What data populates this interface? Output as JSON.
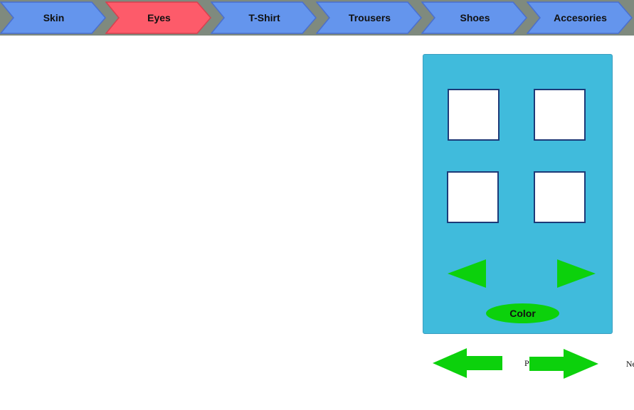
{
  "tabs": [
    {
      "label": "Skin",
      "active": false
    },
    {
      "label": "Eyes",
      "active": true
    },
    {
      "label": "T-Shirt",
      "active": false
    },
    {
      "label": "Trousers",
      "active": false
    },
    {
      "label": "Shoes",
      "active": false
    },
    {
      "label": "Accesories",
      "active": false
    }
  ],
  "colors": {
    "tab": "#6495ed",
    "tab_active": "#fd5b6a",
    "tab_border": "#4a6fcf",
    "tab_active_border": "#d8404f",
    "strip": "#7f8a7e",
    "panel": "#40bbdc",
    "green": "#0cd10c"
  },
  "panel": {
    "color_label": "Color",
    "prev_option_icon": "triangle-left-icon",
    "next_option_icon": "triangle-right-icon"
  },
  "navigation": {
    "previous_label": "Previous",
    "next_label": "Next"
  }
}
